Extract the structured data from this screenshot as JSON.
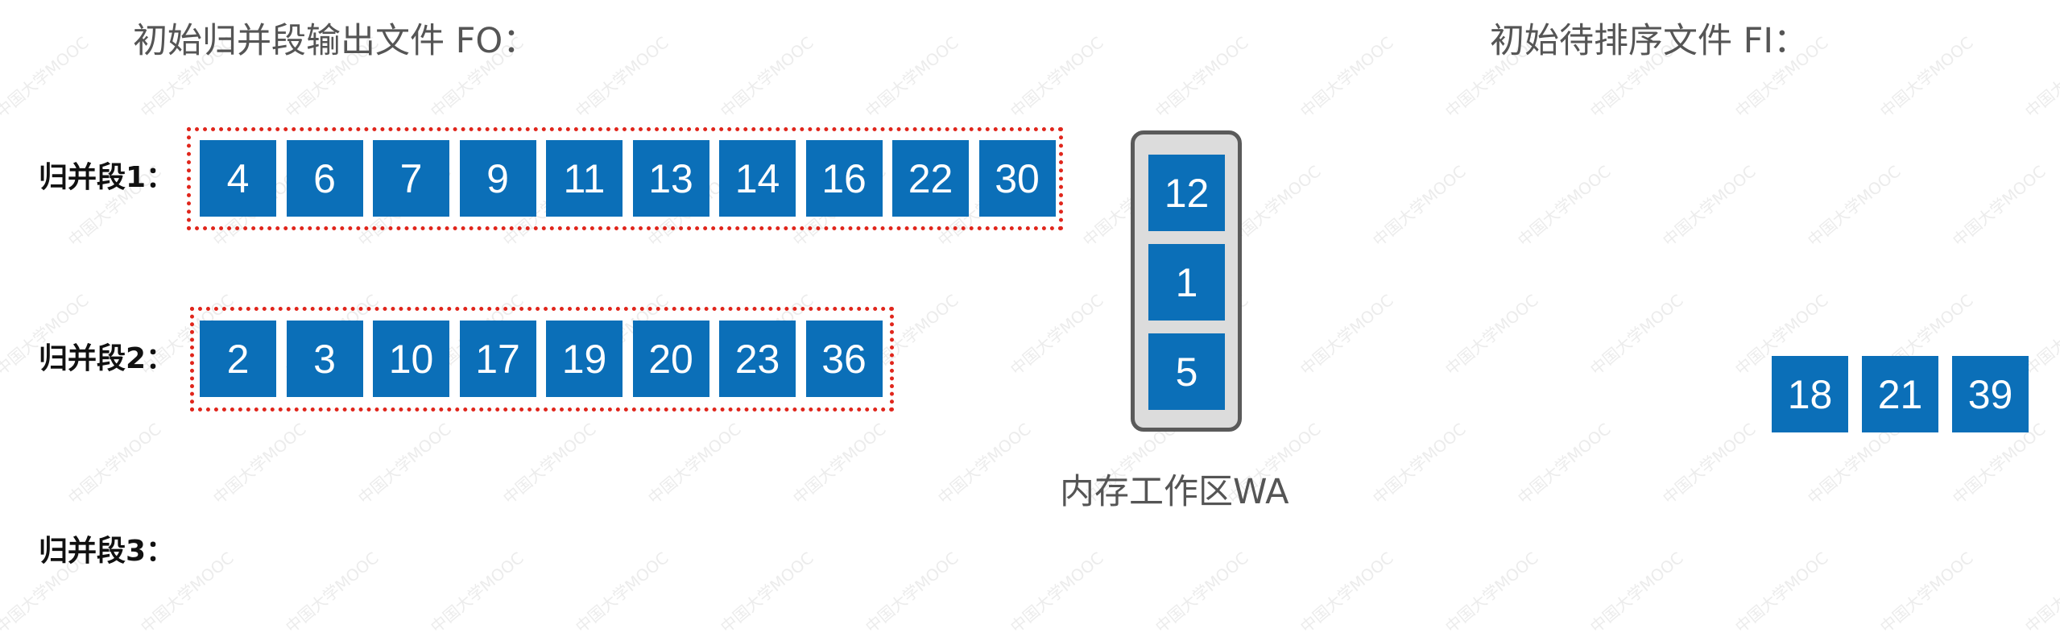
{
  "output_file": {
    "title": "初始归并段输出文件 FO："
  },
  "input_file": {
    "title": "初始待排序文件 FI：",
    "values": [
      "18",
      "21",
      "39"
    ]
  },
  "runs": [
    {
      "label": "归并段1：",
      "values": [
        "4",
        "6",
        "7",
        "9",
        "11",
        "13",
        "14",
        "16",
        "22",
        "30"
      ]
    },
    {
      "label": "归并段2：",
      "values": [
        "2",
        "3",
        "10",
        "17",
        "19",
        "20",
        "23",
        "36"
      ]
    },
    {
      "label": "归并段3：",
      "values": []
    }
  ],
  "work_area": {
    "label": "内存工作区WA",
    "values": [
      "12",
      "1",
      "5"
    ]
  },
  "watermark": "中国大学MOOC",
  "colors": {
    "cell": "#0b6fb8",
    "dotted_border": "#e0261c",
    "wa_fill": "#dcdcdc",
    "wa_border": "#5a5a5a"
  }
}
